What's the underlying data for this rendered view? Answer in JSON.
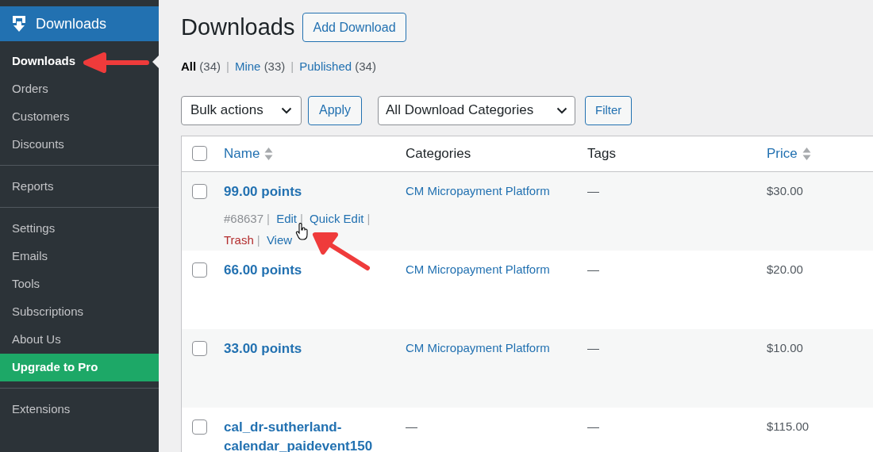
{
  "sidebar": {
    "header": "Downloads",
    "groups": [
      [
        {
          "label": "Downloads",
          "selected": true,
          "kind": "item"
        },
        {
          "label": "Orders",
          "selected": false,
          "kind": "item"
        },
        {
          "label": "Customers",
          "selected": false,
          "kind": "item"
        },
        {
          "label": "Discounts",
          "selected": false,
          "kind": "item"
        }
      ],
      [
        {
          "label": "Reports",
          "selected": false,
          "kind": "item"
        }
      ],
      [
        {
          "label": "Settings",
          "selected": false,
          "kind": "item"
        },
        {
          "label": "Emails",
          "selected": false,
          "kind": "item"
        },
        {
          "label": "Tools",
          "selected": false,
          "kind": "item"
        },
        {
          "label": "Subscriptions",
          "selected": false,
          "kind": "item"
        },
        {
          "label": "About Us",
          "selected": false,
          "kind": "item"
        },
        {
          "label": "Upgrade to Pro",
          "selected": false,
          "kind": "upgrade"
        }
      ],
      [
        {
          "label": "Extensions",
          "selected": false,
          "kind": "item"
        }
      ]
    ]
  },
  "page": {
    "title": "Downloads",
    "add_button": "Add Download"
  },
  "views": [
    {
      "label": "All",
      "count": "(34)",
      "selected": true
    },
    {
      "label": "Mine",
      "count": "(33)",
      "selected": false,
      "separator": "|"
    },
    {
      "label": "Published",
      "count": "(34)",
      "selected": false,
      "separator": "|"
    }
  ],
  "bulk_actions": {
    "value": "Bulk actions",
    "button": "Apply"
  },
  "category_filter": {
    "value": "All Download Categories",
    "button": "Filter"
  },
  "table": {
    "select_all_checked": false,
    "columns": [
      {
        "label": "Name",
        "sortable": true
      },
      {
        "label": "Categories",
        "sortable": false
      },
      {
        "label": "Tags",
        "sortable": false
      },
      {
        "label": "Price",
        "sortable": true
      }
    ],
    "rows": [
      {
        "name": "99.00 points",
        "category": "CM Micropayment Platform",
        "tags": "—",
        "price": "$30.00",
        "checked": false,
        "actions": [
          {
            "kind": "id",
            "label": "#68637"
          },
          {
            "kind": "separator",
            "label": "|"
          },
          {
            "kind": "link",
            "label": "Edit"
          },
          {
            "kind": "separator",
            "label": "|"
          },
          {
            "kind": "link",
            "label": "Quick Edit"
          },
          {
            "kind": "separator",
            "label": "|"
          },
          {
            "kind": "trash",
            "label": "Trash"
          },
          {
            "kind": "separator",
            "label": "|"
          },
          {
            "kind": "link",
            "label": "View"
          }
        ]
      },
      {
        "name": "66.00 points",
        "category": "CM Micropayment Platform",
        "tags": "—",
        "price": "$20.00",
        "checked": false
      },
      {
        "name": "33.00 points",
        "category": "CM Micropayment Platform",
        "tags": "—",
        "price": "$10.00",
        "checked": false
      },
      {
        "name": "cal_dr-sutherland-calendar_paidevent150",
        "category": "—",
        "tags": "—",
        "price": "$115.00",
        "checked": false
      }
    ]
  }
}
